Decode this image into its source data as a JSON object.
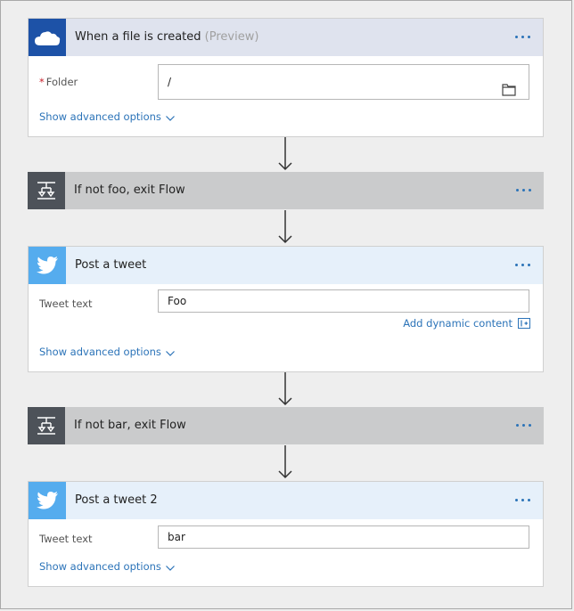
{
  "trigger": {
    "title": "When a file is created",
    "title_suffix": "(Preview)",
    "icon": "onedrive-cloud-icon",
    "folder_label": "Folder",
    "required_mark": "*",
    "folder_value": "/",
    "show_advanced": "Show advanced options"
  },
  "condition1": {
    "title": "If not foo, exit Flow",
    "icon": "condition-icon"
  },
  "tweet1": {
    "title": "Post a tweet",
    "icon": "twitter-bird-icon",
    "field_label": "Tweet text",
    "field_value": "Foo",
    "dynamic_content": "Add dynamic content",
    "show_advanced": "Show advanced options"
  },
  "condition2": {
    "title": "If not bar, exit Flow",
    "icon": "condition-icon"
  },
  "tweet2": {
    "title": "Post a tweet 2",
    "icon": "twitter-bird-icon",
    "field_label": "Tweet text",
    "field_value": "bar",
    "show_advanced": "Show advanced options"
  },
  "colors": {
    "onedrive_blue": "#1d52a7",
    "trigger_header": "#dfe3ee",
    "tweet_header": "#e6f0fa",
    "twitter_blue": "#55acee",
    "condition_bar": "#cacbcc",
    "condition_icon_bg": "#4d5259",
    "link_blue": "#2b73b8"
  }
}
